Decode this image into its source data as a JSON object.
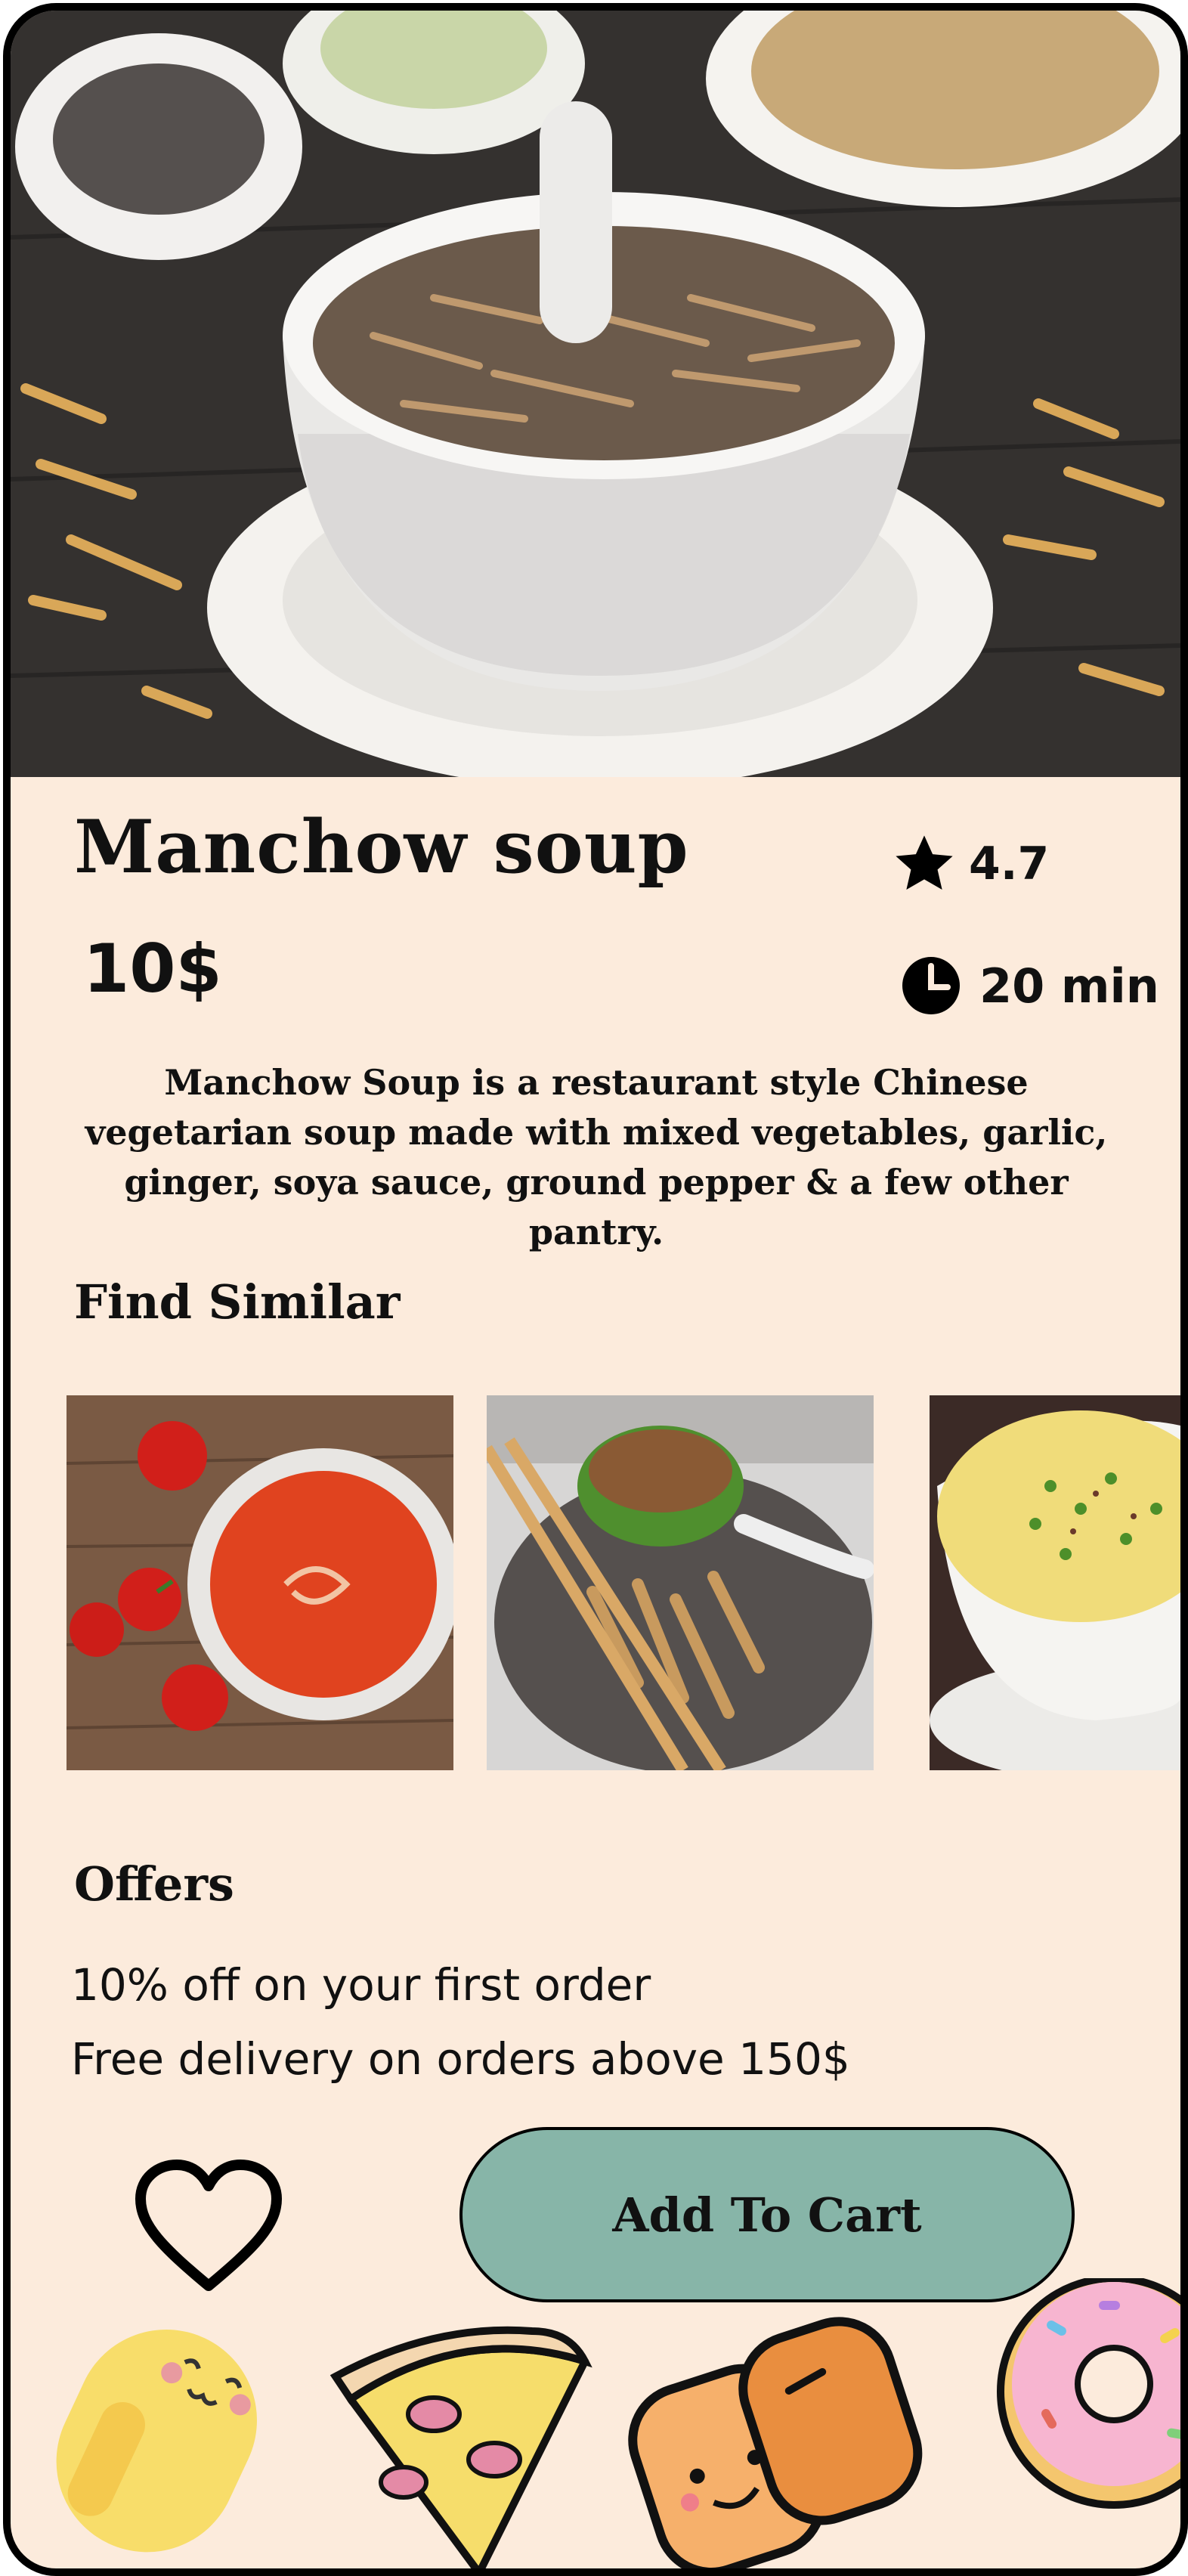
{
  "product": {
    "title": "Manchow soup",
    "rating": "4.7",
    "price": "10$",
    "time": "20 min",
    "description": "Manchow Soup is a restaurant style Chinese vegetarian soup made with mixed vegetables, garlic, ginger, soya sauce, ground pepper & a few other pantry."
  },
  "similar": {
    "heading": "Find Similar",
    "items": [
      "tomato-soup",
      "hot-and-sour-soup",
      "corn-soup"
    ]
  },
  "offers": {
    "heading": "Offers",
    "items": [
      "10% off on your first order",
      "Free delivery on orders above 150$"
    ]
  },
  "actions": {
    "add_to_cart": "Add To Cart"
  },
  "icons": {
    "rating": "star-icon",
    "time": "clock-icon",
    "favorite": "heart-icon"
  },
  "colors": {
    "background": "#fcebdc",
    "button": "#87b5a8",
    "text": "#111111"
  }
}
